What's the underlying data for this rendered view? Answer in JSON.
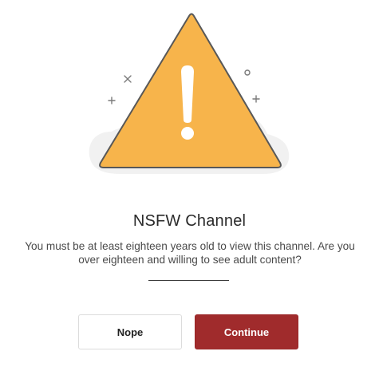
{
  "dialog": {
    "title": "NSFW Channel",
    "message": "You must be at least eighteen years old to view this channel. Are you over eighteen and willing to see adult content?",
    "buttons": {
      "nope_label": "Nope",
      "continue_label": "Continue"
    }
  },
  "icons": {
    "warning": "warning-triangle-icon",
    "exclamation": "exclamation-mark-icon"
  },
  "colors": {
    "warning_fill": "#f7b44b",
    "warning_stroke": "#585858",
    "blob": "#f1f1f1",
    "continue_bg": "#a02b2c",
    "continue_text": "#ffffff",
    "nope_border": "#dcdcdc"
  }
}
